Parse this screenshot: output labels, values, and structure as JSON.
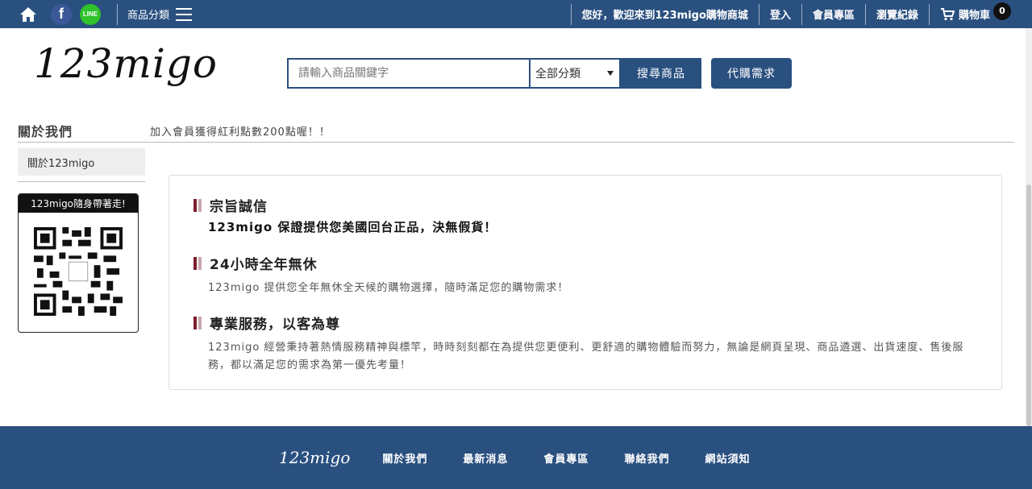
{
  "topbar": {
    "category_label": "商品分類",
    "welcome": "您好，歡迎來到123migo購物商城",
    "login": "登入",
    "member_area": "會員專區",
    "history": "瀏覽紀錄",
    "cart": "購物車",
    "cart_count": "0",
    "fb_glyph": "f",
    "line_glyph": "LINE"
  },
  "header": {
    "logo": "123migo",
    "search_placeholder": "請輸入商品關鍵字",
    "category_select": "全部分類",
    "search_button": "搜尋商品",
    "proxy_button": "代購需求"
  },
  "sidebar": {
    "title": "關於我們",
    "items": [
      {
        "label": "關於123migo"
      }
    ],
    "qr_caption": "123migo隨身帶著走!"
  },
  "marquee": "加入會員獲得紅利點數200點喔！！",
  "content": {
    "sections": [
      {
        "title": "宗旨誠信",
        "text": "123migo 保證提供您美國回台正品，決無假貨！"
      },
      {
        "title": "24小時全年無休",
        "text": "123migo 提供您全年無休全天候的購物選擇，隨時滿足您的購物需求！"
      },
      {
        "title": "專業服務，以客為尊",
        "text": "123migo 經營秉持著熱情服務精神與標竿，時時刻刻都在為提供您更便利、更舒適的購物體驗而努力，無論是網頁呈現、商品遴選、出貨速度、售後服務，都以滿足您的需求為第一優先考量！"
      }
    ]
  },
  "footer": {
    "logo": "123migo",
    "links": [
      "關於我們",
      "最新消息",
      "會員專區",
      "聯絡我們",
      "網站須知"
    ]
  },
  "colors": {
    "brand": "#2a5080",
    "accent": "#7a1f2e"
  }
}
